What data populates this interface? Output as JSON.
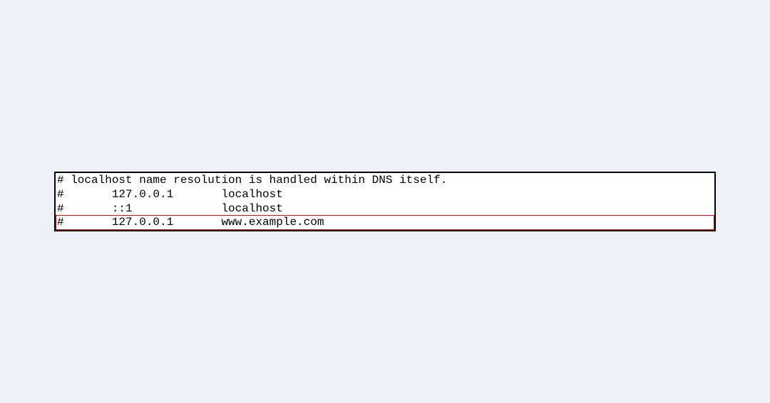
{
  "hosts_file": {
    "lines": [
      "# localhost name resolution is handled within DNS itself.",
      "#       127.0.0.1       localhost",
      "#       ::1             localhost"
    ],
    "highlighted_line": "#       127.0.0.1       www.example.com"
  }
}
